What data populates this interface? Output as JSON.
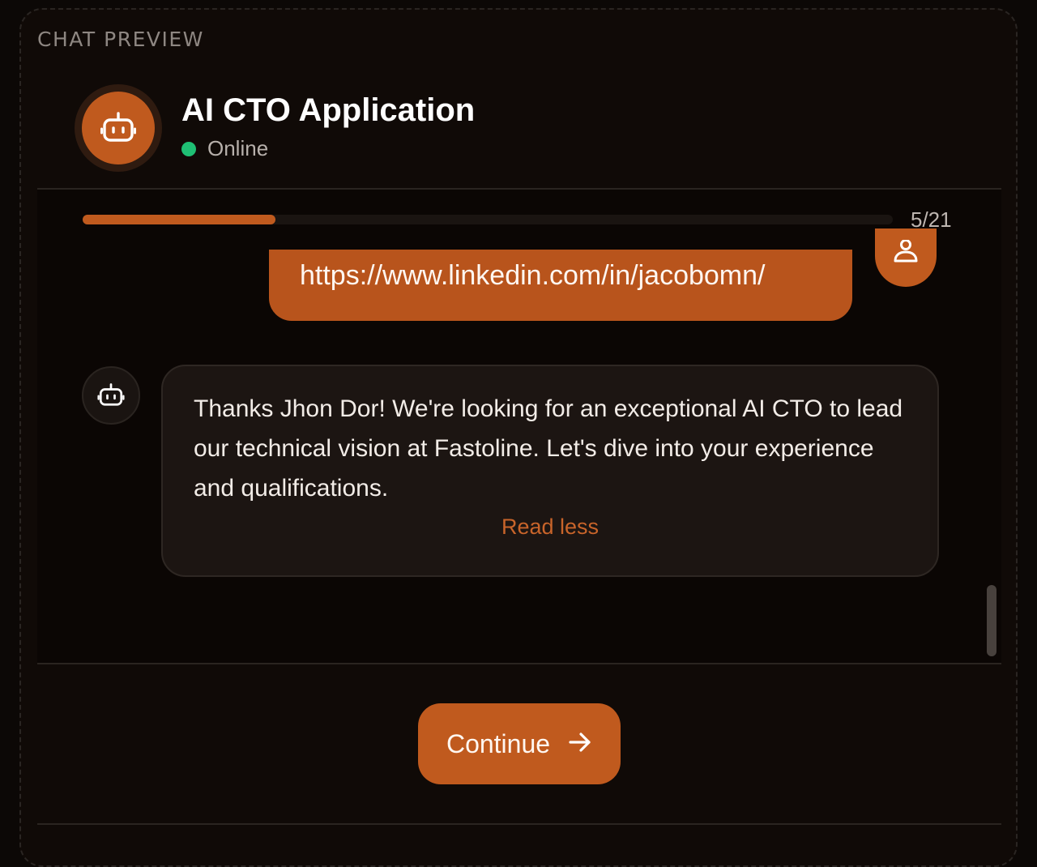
{
  "section": {
    "label": "CHAT PREVIEW"
  },
  "header": {
    "title": "AI CTO Application",
    "status": "Online",
    "status_color": "#1fbf74",
    "avatar_icon": "bot-icon"
  },
  "progress": {
    "text": "5/21",
    "current": 5,
    "total": 21,
    "fill_color": "#c05a1e"
  },
  "messages": {
    "user": {
      "text": "https://www.linkedin.com/in/jacobomn/",
      "avatar_icon": "user-icon"
    },
    "bot": {
      "text": "Thanks Jhon Dor! We're looking for an exceptional AI CTO to lead our technical vision at Fastoline. Let's dive into your experience and qualifications.",
      "toggle_label": "Read less",
      "avatar_icon": "bot-icon"
    }
  },
  "footer": {
    "continue_label": "Continue",
    "continue_icon": "arrow-right-icon"
  },
  "colors": {
    "accent": "#c05a1e",
    "background": "#100a07"
  }
}
